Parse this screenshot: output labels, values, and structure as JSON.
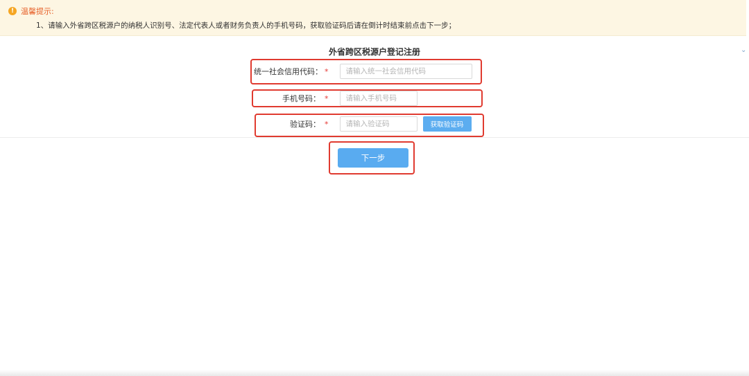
{
  "notice": {
    "icon": "warning-icon",
    "title": "温馨提示:",
    "text": "1、请输入外省跨区税源户的纳税人识别号、法定代表人或者财务负责人的手机号码，获取验证码后请在倒计时结束前点击下一步；"
  },
  "form": {
    "title": "外省跨区税源户登记注册",
    "credit_code": {
      "label": "统一社会信用代码：",
      "required": "*",
      "placeholder": "请输入统一社会信用代码",
      "value": ""
    },
    "phone": {
      "label": "手机号码：",
      "required": "*",
      "placeholder": "请输入手机号码",
      "value": ""
    },
    "verify_code": {
      "label": "验证码：",
      "required": "*",
      "placeholder": "请输入验证码",
      "value": "",
      "button": "获取验证码"
    },
    "next_button": "下一步"
  },
  "colors": {
    "accent_button": "#59abf0",
    "highlight_box": "#e03a2f",
    "notice_bg": "#fdf6e3",
    "notice_title": "#e6612a",
    "required": "#e53935"
  }
}
